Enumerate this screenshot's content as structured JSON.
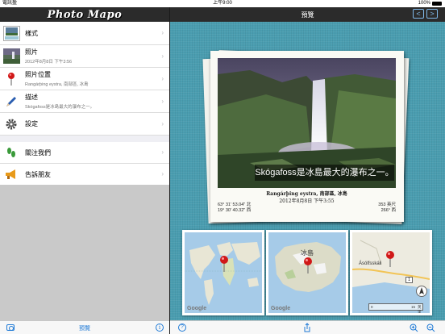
{
  "status_bar": {
    "carrier": "電訊盈",
    "time": "上午9:00",
    "battery": "100%"
  },
  "left": {
    "app_logo": "Photo Mapo",
    "menu": [
      {
        "id": "style",
        "label": "樣式",
        "sub": "",
        "icon": "style-thumbnail-icon"
      },
      {
        "id": "photo",
        "label": "照片",
        "sub": "2012年8月8日 下午3:56",
        "icon": "photo-thumbnail-icon"
      },
      {
        "id": "location",
        "label": "照片位置",
        "sub": "Rangárþing eystra, 南部區, 冰島",
        "icon": "map-pin-icon"
      },
      {
        "id": "description",
        "label": "描述",
        "sub": "Skógafoss是冰島最大的瀑布之一。",
        "icon": "pen-icon"
      },
      {
        "id": "settings",
        "label": "設定",
        "sub": "",
        "icon": "gear-icon"
      }
    ],
    "menu2": [
      {
        "id": "follow",
        "label": "關注我們",
        "icon": "footprints-icon"
      },
      {
        "id": "share",
        "label": "告訴朋友",
        "icon": "megaphone-icon"
      }
    ],
    "toolbar": {
      "center_label": "預覽"
    }
  },
  "right": {
    "title": "預覽",
    "prev": "<",
    "next": ">",
    "polaroid": {
      "caption": "Skógafoss是冰島最大的瀑布之一。",
      "location": "Rangárþing eystra, 南部區, 冰島",
      "datetime": "2012年8月8日 下午3:55",
      "lat": "63° 31' 53.04\" 北",
      "lon": "19° 30' 40.32\" 西",
      "altitude": "353 英尺",
      "heading": "266° 西"
    },
    "maps": [
      {
        "id": "world",
        "logo": "Google"
      },
      {
        "id": "country",
        "logo": "Google",
        "label": "冰島"
      },
      {
        "id": "local",
        "label": "Ásólfsskáli",
        "road": "1",
        "scale_0": "0",
        "scale_1": "15",
        "scale_unit": "英里"
      }
    ]
  },
  "colors": {
    "accent": "#1f7ad6",
    "canvas": "#4a9db0",
    "header": "#2b2b2b"
  }
}
